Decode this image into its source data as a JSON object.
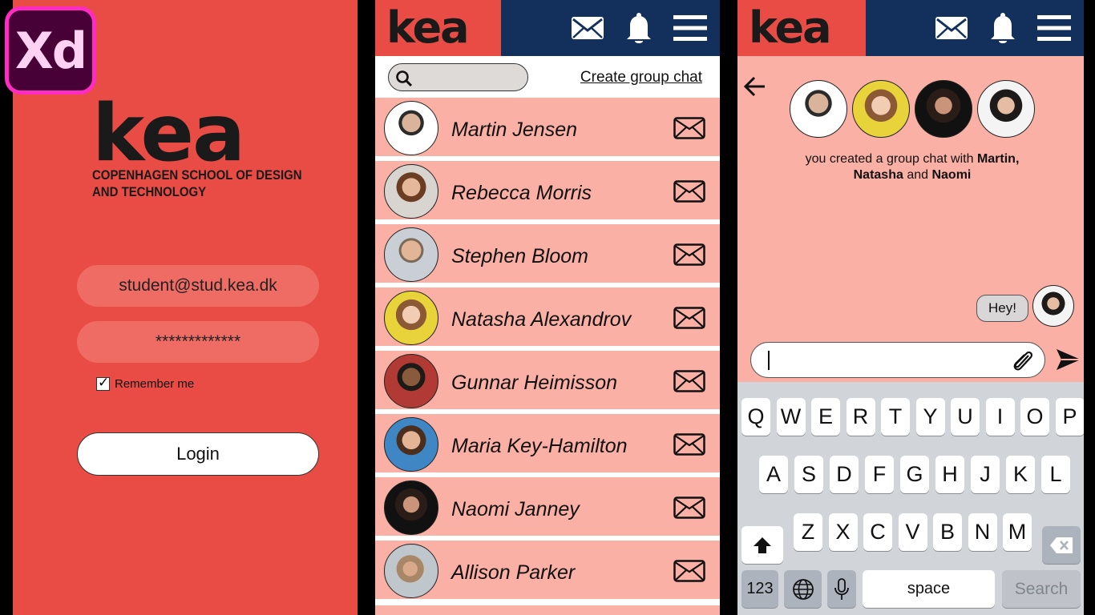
{
  "badge": {
    "label": "Xd"
  },
  "login": {
    "logo": "kea",
    "tagline": "COPENHAGEN SCHOOL OF DESIGN AND TECHNOLOGY",
    "email_value": "student@stud.kea.dk",
    "password_value": "*************",
    "remember_label": "Remember me",
    "remember_checked": true,
    "login_label": "Login"
  },
  "header": {
    "logo": "kea",
    "icons": [
      "envelope-icon",
      "bell-icon",
      "menu-icon"
    ],
    "logo_bg": "#e84c45",
    "nav_bg": "#12305b"
  },
  "contacts": {
    "search_placeholder": "",
    "create_group_label": "Create group chat",
    "items": [
      {
        "name": "Martin Jensen"
      },
      {
        "name": "Rebecca Morris"
      },
      {
        "name": "Stephen Bloom"
      },
      {
        "name": "Natasha Alexandrov"
      },
      {
        "name": "Gunnar Heimisson"
      },
      {
        "name": "Maria Key-Hamilton"
      },
      {
        "name": "Naomi Janney"
      },
      {
        "name": "Allison Parker"
      }
    ]
  },
  "chat": {
    "msg_prefix": "you created a group chat with ",
    "msg_names_1": "Martin,",
    "msg_names_2": "Natasha",
    "msg_and": " and ",
    "msg_names_3": "Naomi",
    "bubble": "Hey!",
    "input_value": ""
  },
  "keyboard": {
    "row1": [
      "Q",
      "W",
      "E",
      "R",
      "T",
      "Y",
      "U",
      "I",
      "O",
      "P"
    ],
    "row2": [
      "A",
      "S",
      "D",
      "F",
      "G",
      "H",
      "J",
      "K",
      "L"
    ],
    "row3": [
      "Z",
      "X",
      "C",
      "V",
      "B",
      "N",
      "M"
    ],
    "numbers_label": "123",
    "space_label": "space",
    "search_label": "Search"
  },
  "colors": {
    "accent": "#e84c45",
    "row_bg": "#fbb0a5",
    "navy": "#12305b"
  }
}
